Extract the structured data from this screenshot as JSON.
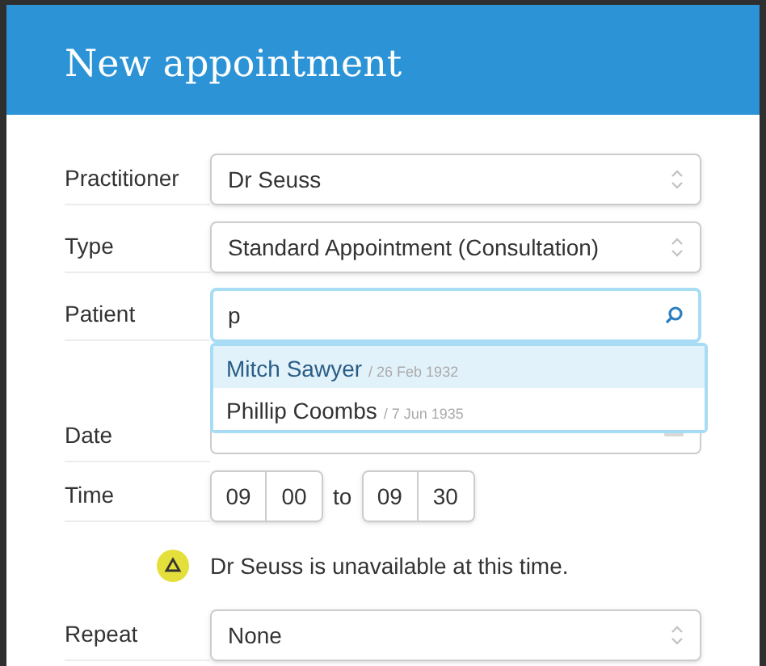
{
  "dialog": {
    "title": "New appointment"
  },
  "fields": [
    {
      "kind": "select",
      "label": "Practitioner",
      "value": "Dr Seuss"
    },
    {
      "kind": "select",
      "label": "Type",
      "value": "Standard Appointment (Consultation)"
    },
    {
      "kind": "search",
      "label": "Patient",
      "value": "p",
      "suggestions": [
        {
          "name": "Mitch Sawyer",
          "dob": "/ 26 Feb 1932",
          "selected": true
        },
        {
          "name": "Phillip Coombs",
          "dob": "/ 7 Jun 1935",
          "selected": false
        }
      ]
    },
    {
      "kind": "date",
      "label": "Date"
    },
    {
      "kind": "time",
      "label": "Time",
      "from_hour": "09",
      "from_minute": "00",
      "separator": "to",
      "to_hour": "09",
      "to_minute": "30"
    },
    {
      "kind": "warning",
      "text": "Dr Seuss is unavailable at this time."
    },
    {
      "kind": "select",
      "label": "Repeat",
      "value": "None"
    }
  ]
}
